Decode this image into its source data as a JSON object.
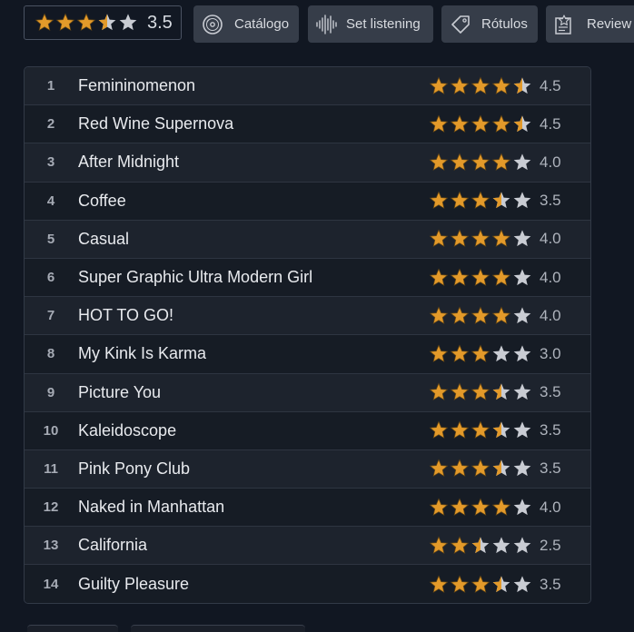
{
  "header": {
    "rating_value": "3.5",
    "rating_stars": 3.5,
    "buttons": [
      {
        "label": "Catálogo",
        "icon": "vinyl-icon"
      },
      {
        "label": "Set listening",
        "icon": "waveform-icon"
      },
      {
        "label": "Rótulos",
        "icon": "tag-icon"
      },
      {
        "label": "Review",
        "icon": "review-icon"
      }
    ]
  },
  "colors": {
    "star_gold": "#e39a2a",
    "star_empty": "#c9ccd3",
    "background": "#111722"
  },
  "tracks": [
    {
      "num": "1",
      "title": "Femininomenon",
      "rating": "4.5",
      "stars": 4.5
    },
    {
      "num": "2",
      "title": "Red Wine Supernova",
      "rating": "4.5",
      "stars": 4.5
    },
    {
      "num": "3",
      "title": "After Midnight",
      "rating": "4.0",
      "stars": 4.0
    },
    {
      "num": "4",
      "title": "Coffee",
      "rating": "3.5",
      "stars": 3.5
    },
    {
      "num": "5",
      "title": "Casual",
      "rating": "4.0",
      "stars": 4.0
    },
    {
      "num": "6",
      "title": "Super Graphic Ultra Modern Girl",
      "rating": "4.0",
      "stars": 4.0
    },
    {
      "num": "7",
      "title": "HOT TO GO!",
      "rating": "4.0",
      "stars": 4.0
    },
    {
      "num": "8",
      "title": "My Kink Is Karma",
      "rating": "3.0",
      "stars": 3.0
    },
    {
      "num": "9",
      "title": "Picture You",
      "rating": "3.5",
      "stars": 3.5
    },
    {
      "num": "10",
      "title": "Kaleidoscope",
      "rating": "3.5",
      "stars": 3.5
    },
    {
      "num": "11",
      "title": "Pink Pony Club",
      "rating": "3.5",
      "stars": 3.5
    },
    {
      "num": "12",
      "title": "Naked in Manhattan",
      "rating": "4.0",
      "stars": 4.0
    },
    {
      "num": "13",
      "title": "California",
      "rating": "2.5",
      "stars": 2.5
    },
    {
      "num": "14",
      "title": "Guilty Pleasure",
      "rating": "3.5",
      "stars": 3.5
    }
  ]
}
